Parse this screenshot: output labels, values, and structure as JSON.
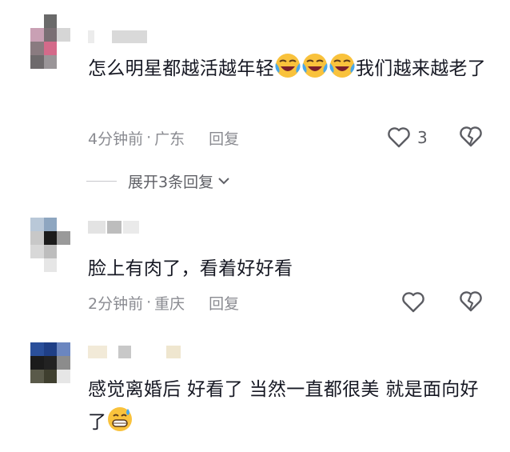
{
  "comments": [
    {
      "text_parts": [
        "怎么明星都越活越年轻",
        "我们越来越老了"
      ],
      "emoji": "crying-laughing-emoji",
      "time": "4分钟前",
      "separator": "·",
      "location": "广东",
      "reply_label": "回复",
      "like_count": "3"
    },
    {
      "text": "脸上有肉了，看着好好看",
      "time": "2分钟前",
      "separator": "·",
      "location": "重庆",
      "reply_label": "回复",
      "like_count": ""
    },
    {
      "text_parts": [
        "感觉离婚后 好看了 当然一直都很美 就是面向好了"
      ],
      "emoji": "grinning-sweat-emoji",
      "time": "",
      "location": "",
      "reply_label": "",
      "like_count": ""
    }
  ],
  "expand_replies_label": "展开3条回复",
  "icons": {
    "like": "heart-outline-icon",
    "dislike": "broken-heart-icon",
    "chevron": "chevron-down-icon"
  },
  "colors": {
    "text": "#161823",
    "meta": "#8a8b91",
    "emoji_yellow": "#f9c23c"
  }
}
